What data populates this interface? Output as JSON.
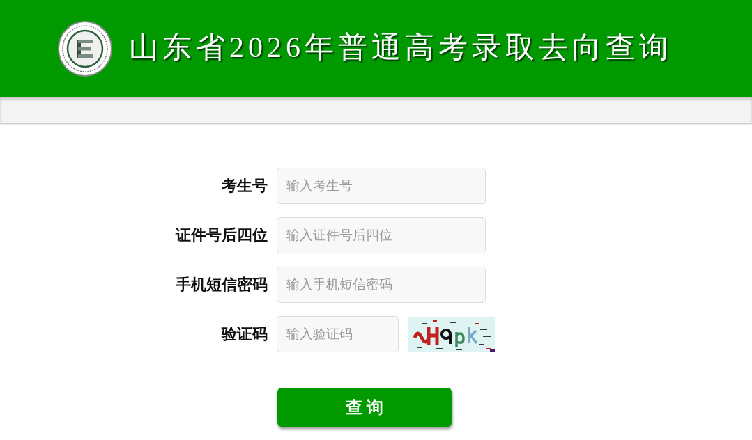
{
  "header": {
    "title": "山东省2026年普通高考录取去向查询"
  },
  "form": {
    "fields": [
      {
        "kind": "text",
        "label": "考生号",
        "placeholder": "输入考生号"
      },
      {
        "kind": "text",
        "label": "证件号后四位",
        "placeholder": "输入证件号后四位"
      },
      {
        "kind": "text",
        "label": "手机短信密码",
        "placeholder": "输入手机短信密码"
      },
      {
        "kind": "captcha",
        "label": "验证码",
        "placeholder": "输入验证码"
      }
    ]
  },
  "submit_button": {
    "label": "查 询"
  }
}
